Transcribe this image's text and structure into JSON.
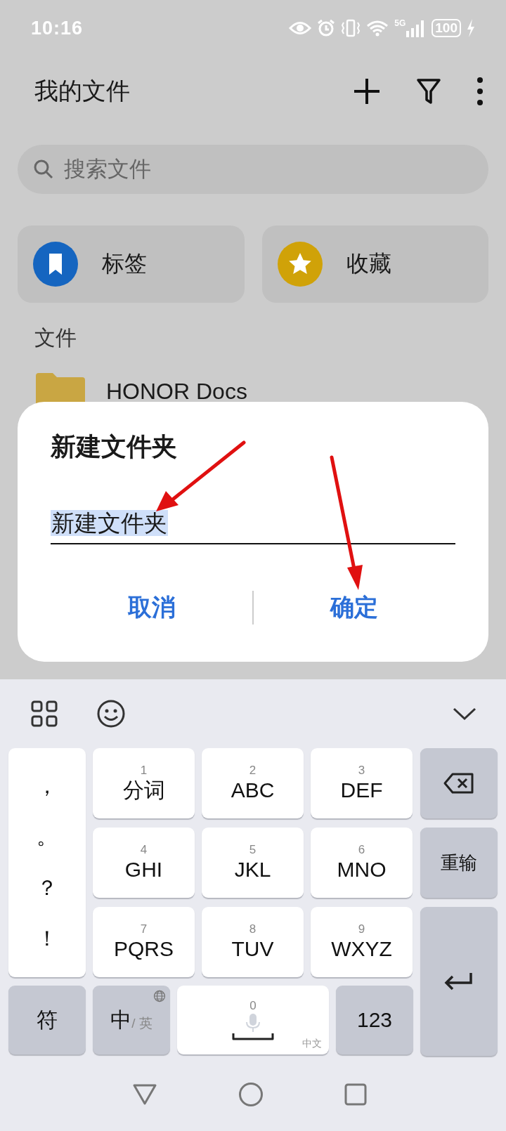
{
  "status_bar": {
    "time": "10:16",
    "network": "5G",
    "battery": "100"
  },
  "header": {
    "title": "我的文件"
  },
  "search": {
    "placeholder": "搜索文件"
  },
  "quick_cards": [
    {
      "kind": "tags",
      "label": "标签"
    },
    {
      "kind": "favorites",
      "label": "收藏"
    }
  ],
  "section_label": "文件",
  "files": [
    {
      "name": "HONOR Docs"
    }
  ],
  "dialog": {
    "title": "新建文件夹",
    "input": {
      "value": "新建文件夹",
      "selected": true
    },
    "buttons": [
      "取消",
      "确定"
    ]
  },
  "keyboard": {
    "punctuation": [
      "，",
      "。",
      "？",
      "！"
    ],
    "keys": [
      {
        "number": "1",
        "label": "分词"
      },
      {
        "number": "2",
        "label": "ABC"
      },
      {
        "number": "3",
        "label": "DEF"
      },
      {
        "number": "4",
        "label": "GHI"
      },
      {
        "number": "5",
        "label": "JKL"
      },
      {
        "number": "6",
        "label": "MNO"
      },
      {
        "number": "7",
        "label": "PQRS"
      },
      {
        "number": "8",
        "label": "TUV"
      },
      {
        "number": "9",
        "label": "WXYZ"
      }
    ],
    "side_keys": [
      {
        "kind": "delete"
      },
      {
        "kind": "text",
        "label": "重输"
      },
      {
        "kind": "enter"
      }
    ],
    "bottom_row": [
      {
        "kind": "text",
        "label": "符"
      },
      {
        "kind": "lang",
        "label": "中",
        "sub": "/ 英"
      },
      {
        "kind": "space",
        "number": "0",
        "sub": "中文"
      },
      {
        "kind": "text",
        "label": "123"
      }
    ]
  }
}
